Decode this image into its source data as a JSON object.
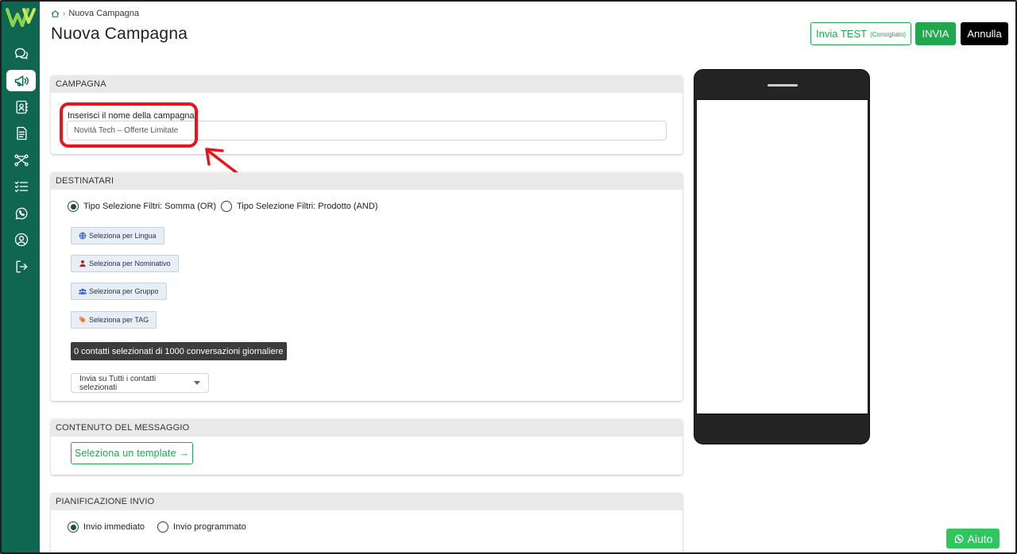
{
  "app": {
    "logo_letter": "W"
  },
  "sidebar": {
    "items": [
      {
        "icon": "chat-bubbles-icon",
        "active": false
      },
      {
        "icon": "megaphone-icon",
        "active": true
      },
      {
        "icon": "contacts-book-icon",
        "active": false
      },
      {
        "icon": "document-icon",
        "active": false
      },
      {
        "icon": "flow-nodes-icon",
        "active": false
      },
      {
        "icon": "checklist-icon",
        "active": false
      },
      {
        "icon": "whatsapp-icon",
        "active": false
      },
      {
        "icon": "user-circle-icon",
        "active": false
      },
      {
        "icon": "logout-icon",
        "active": false
      }
    ]
  },
  "header": {
    "breadcrumb": "Nuova Campagna",
    "title": "Nuova Campagna",
    "test_label": "Invia TEST",
    "test_note": "(Consigliato)",
    "send_label": "INVIA",
    "cancel_label": "Annulla"
  },
  "campaign": {
    "section_title": "CAMPAGNA",
    "name_label": "Inserisci il nome della campagna",
    "required_mark": "*",
    "name_value": "Novità Tech – Offerte Limitate"
  },
  "recipients": {
    "section_title": "DESTINATARI",
    "filter_mode_or": "Tipo Selezione Filtri: Somma (OR)",
    "filter_mode_and": "Tipo Selezione Filtri: Prodotto (AND)",
    "filter_mode_selected": "or",
    "filters": [
      {
        "label": "Seleziona per Lingua",
        "icon": "globe-icon",
        "color": "#2f5bd3"
      },
      {
        "label": "Seleziona per Nominativo",
        "icon": "person-icon",
        "color": "#b3261e"
      },
      {
        "label": "Seleziona per Gruppo",
        "icon": "users-icon",
        "color": "#2f5bd3"
      },
      {
        "label": "Seleziona per TAG",
        "icon": "tags-icon",
        "color": "#ef7d32"
      }
    ],
    "count_text": "0 contatti selezionati di 1000 conversazioni giornaliere",
    "send_to_selected": "Invia su Tutti i contatti selezionati"
  },
  "content": {
    "section_title": "CONTENUTO DEL MESSAGGIO",
    "select_template": "Seleziona un template →"
  },
  "schedule": {
    "section_title": "PIANIFICAZIONE INVIO",
    "immediate": "Invio immediato",
    "scheduled": "Invio programmato",
    "selected": "immediate"
  },
  "help": {
    "label": "Aiuto"
  },
  "colors": {
    "sidebar": "#0f6651",
    "brand_green": "#21a74e",
    "annotation_red": "#e8141b"
  }
}
